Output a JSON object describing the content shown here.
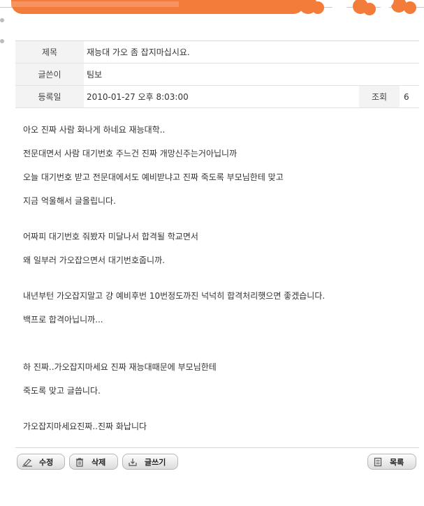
{
  "post": {
    "title_label": "제목",
    "title": "재능대 가오 좀 잡지마십시요.",
    "author_label": "글쓴이",
    "author": "팀보",
    "date_label": "등록일",
    "date": "2010-01-27 오후 8:03:00",
    "views_label": "조회",
    "views": "6"
  },
  "body": {
    "lines": [
      "아오 진짜 사람 화나게 하네요 재능대학..",
      "전문대면서 사람 대기번호 주느건 진짜 개망신주는거아닙니까",
      "오늘 대기번호 받고 전문대에서도 예비받냐고 진짜 죽도록 부모님한테 맞고",
      "지금 억울해서 글올립니다.",
      "",
      "어짜피 대기번호 줘봤자 미달나서 합격될 학교면서",
      "왜 일부러 가오잡으면서 대기번호줍니까.",
      "",
      "내년부턴 가오잡지말고 걍 예비후번 10번정도까진 넉넉히 합격처리햇으면 좋겠습니다.",
      "백프로 합격아닙니까...",
      "",
      "",
      "하 진짜..가오잡지마세요 진짜 재능대때문에 부모님한테",
      "죽도록 맞고 글씁니다.",
      "",
      "가오잡지마세요진짜..진짜 화납니다"
    ]
  },
  "buttons": {
    "edit": "수정",
    "delete": "삭제",
    "write": "글쓰기",
    "list": "목록"
  },
  "icons": {
    "edit": "pencil-icon",
    "delete": "trash-icon",
    "write": "download-tray-icon",
    "list": "document-list-icon"
  },
  "colors": {
    "banner": "#f47c3a",
    "label_bg": "#f3f3f3"
  }
}
